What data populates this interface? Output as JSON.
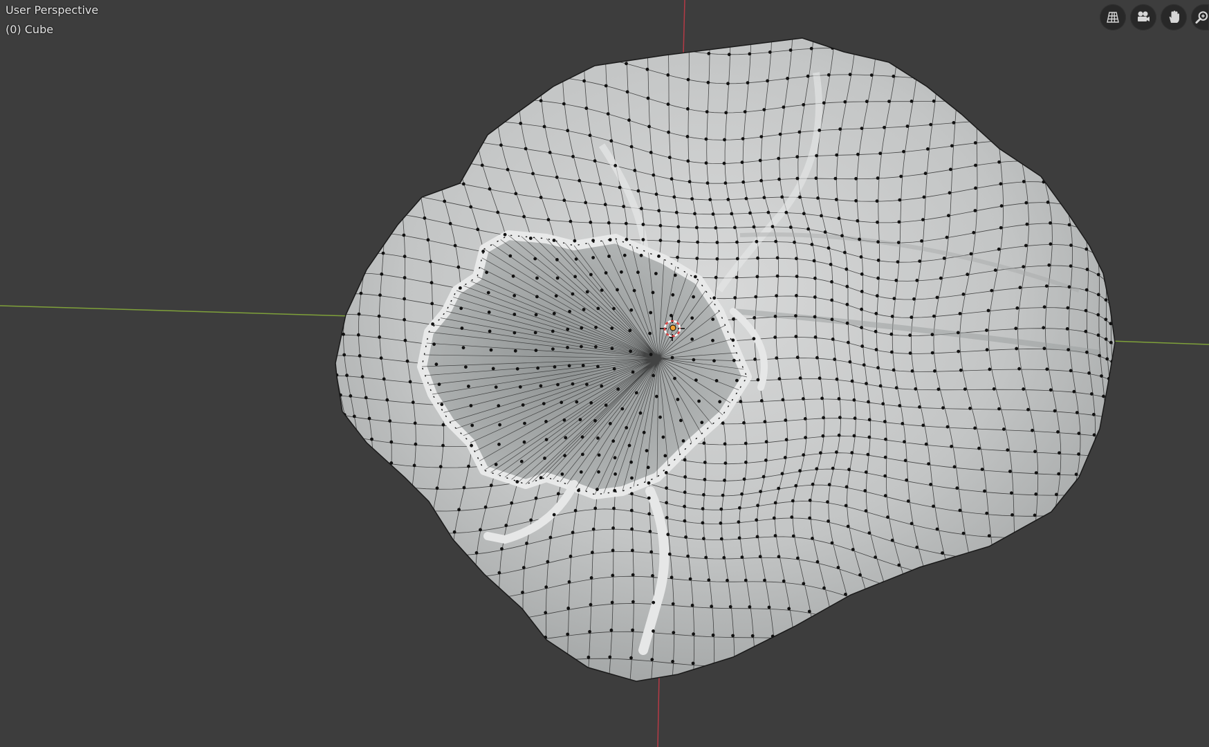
{
  "viewport": {
    "view_name": "User Perspective",
    "object_name": "(0) Cube",
    "background_color": "#3d3d3d",
    "axis_x_color": "#7fa13a",
    "axis_y_color": "#b53a46",
    "mesh_color": "#c9cbcb",
    "wire_color": "#1a1a1a"
  },
  "nav_gizmos": [
    {
      "name": "toggle-camera-view-button",
      "icon": "perspective-grid-icon"
    },
    {
      "name": "camera-view-button",
      "icon": "camera-icon"
    },
    {
      "name": "pan-view-button",
      "icon": "hand-icon"
    },
    {
      "name": "zoom-view-button",
      "icon": "zoom-icon"
    }
  ]
}
